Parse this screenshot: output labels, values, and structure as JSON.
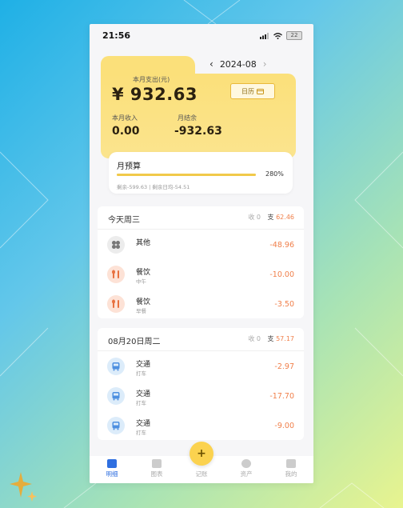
{
  "status": {
    "time": "21:56",
    "battery": "22"
  },
  "header": {
    "month": "2024-08",
    "calendar_label": "日历"
  },
  "summary": {
    "spend_label": "本月支出(元)",
    "spend_value": "¥ 932.63",
    "income_label": "本月收入",
    "income_value": "0.00",
    "balance_label": "月结余",
    "balance_value": "-932.63"
  },
  "budget": {
    "title": "月预算",
    "percent_text": "280%",
    "percent": 280,
    "remain_text": "剩余-599.63 | 剩余日均-54.51"
  },
  "groups": [
    {
      "date": "今天周三",
      "income_label": "收",
      "income_value": "0",
      "expense_label": "支",
      "expense_value": "62.46",
      "items": [
        {
          "category": "其他",
          "note": "",
          "amount": "-48.96",
          "icon": "clover-icon",
          "color": "gray"
        },
        {
          "category": "餐饮",
          "note": "中午",
          "amount": "-10.00",
          "icon": "utensils-icon",
          "color": "orange"
        },
        {
          "category": "餐饮",
          "note": "早餐",
          "amount": "-3.50",
          "icon": "utensils-icon",
          "color": "orange"
        }
      ]
    },
    {
      "date": "08月20日周二",
      "income_label": "收",
      "income_value": "0",
      "expense_label": "支",
      "expense_value": "57.17",
      "items": [
        {
          "category": "交通",
          "note": "打车",
          "amount": "-2.97",
          "icon": "bus-icon",
          "color": "blue"
        },
        {
          "category": "交通",
          "note": "打车",
          "amount": "-17.70",
          "icon": "bus-icon",
          "color": "blue"
        },
        {
          "category": "交通",
          "note": "打车",
          "amount": "-9.00",
          "icon": "bus-icon",
          "color": "blue"
        }
      ]
    }
  ],
  "tabs": [
    {
      "label": "明细",
      "active": true
    },
    {
      "label": "图表",
      "active": false
    },
    {
      "label": "记账",
      "active": false
    },
    {
      "label": "资产",
      "active": false
    },
    {
      "label": "我的",
      "active": false
    }
  ],
  "colors": {
    "accent": "#fbe07a",
    "expense": "#f07f4a",
    "active_tab": "#2f6fe0"
  }
}
